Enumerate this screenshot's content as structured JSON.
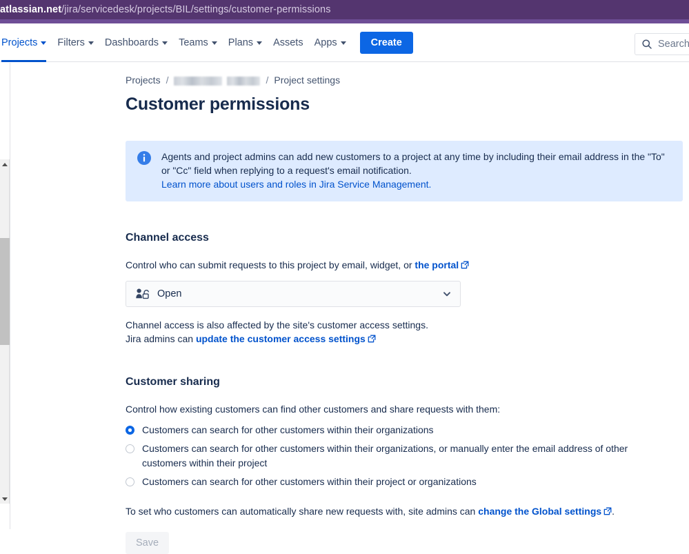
{
  "browser": {
    "url_host": "atlassian.net",
    "url_path": "/jira/servicedesk/projects/BIL/settings/customer-permissions"
  },
  "topnav": {
    "items": [
      {
        "label": "Projects",
        "has_caret": true,
        "active": true
      },
      {
        "label": "Filters",
        "has_caret": true,
        "active": false
      },
      {
        "label": "Dashboards",
        "has_caret": true,
        "active": false
      },
      {
        "label": "Teams",
        "has_caret": true,
        "active": false
      },
      {
        "label": "Plans",
        "has_caret": true,
        "active": false
      },
      {
        "label": "Assets",
        "has_caret": false,
        "active": false
      },
      {
        "label": "Apps",
        "has_caret": true,
        "active": false
      }
    ],
    "create_label": "Create",
    "search_placeholder": "Search"
  },
  "breadcrumb": {
    "projects": "Projects",
    "separator": "/",
    "project_name_redacted": true,
    "project_settings": "Project settings"
  },
  "page": {
    "title": "Customer permissions"
  },
  "info_banner": {
    "icon": "info-icon",
    "line1": "Agents and project admins can add new customers to a project at any time by including their email address in the",
    "line2": "\"To\" or \"Cc\" field when replying to a request's email notification.",
    "link": "Learn more about users and roles in Jira Service Management."
  },
  "channel_access": {
    "heading": "Channel access",
    "description_prefix": "Control who can submit requests to this project by email, widget, or ",
    "description_link": "the portal",
    "select_value": "Open",
    "select_icon": "person-unlocked-icon",
    "note_line1": "Channel access is also affected by the site's customer access settings.",
    "note_line2_prefix": "Jira admins can ",
    "note_line2_link": "update the customer access settings"
  },
  "customer_sharing": {
    "heading": "Customer sharing",
    "description": "Control how existing customers can find other customers and share requests with them:",
    "options": [
      {
        "label": "Customers can search for other customers within their organizations",
        "selected": true
      },
      {
        "label": "Customers can search for other customers within their organizations, or manually enter the email address of other customers within their project",
        "selected": false
      },
      {
        "label": "Customers can search for other customers within their project or organizations",
        "selected": false
      }
    ],
    "global_note_prefix": "To set who customers can automatically share new requests with, site admins can ",
    "global_note_link": "change the Global settings",
    "global_note_suffix": "."
  },
  "actions": {
    "save_label": "Save",
    "save_disabled": true
  },
  "colors": {
    "url_bar": "#54356F",
    "url_strip": "#6E4E96",
    "accent_blue": "#0052CC",
    "create_blue": "#0C66E4",
    "banner_bg": "#DEEBFF",
    "text": "#172B4D"
  }
}
